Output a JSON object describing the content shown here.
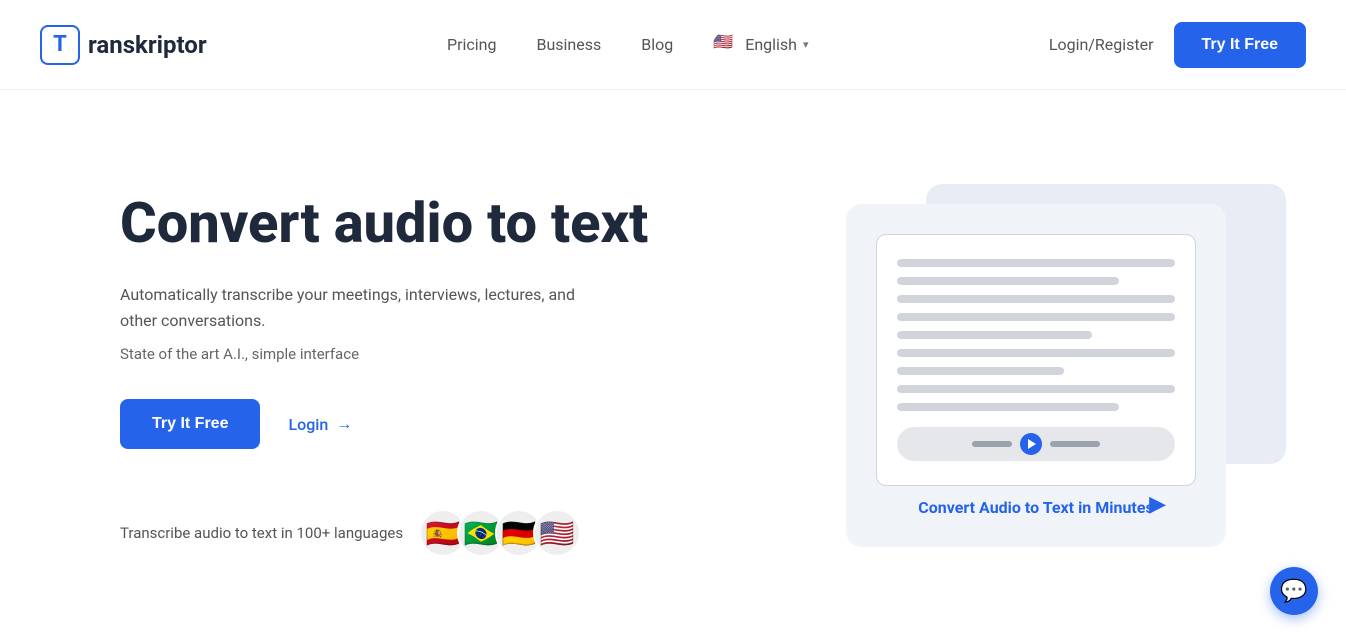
{
  "nav": {
    "logo_letter": "T",
    "logo_name": "ranskriptor",
    "links": [
      {
        "label": "Pricing",
        "href": "#"
      },
      {
        "label": "Business",
        "href": "#"
      },
      {
        "label": "Blog",
        "href": "#"
      }
    ],
    "language": "English",
    "login_label": "Login/Register",
    "try_btn": "Try It Free"
  },
  "hero": {
    "title": "Convert audio to text",
    "description": "Automatically transcribe your meetings, interviews, lectures, and other conversations.",
    "subtitle": "State of the art A.I., simple interface",
    "try_btn": "Try It Free",
    "login_label": "Login",
    "languages_text": "Transcribe audio to text in 100+ languages",
    "flags": [
      "🇪🇸",
      "🇧🇷",
      "🇩🇪",
      "🇺🇸"
    ]
  },
  "illustration": {
    "convert_label": "Convert Audio to Text in Minutes"
  },
  "colors": {
    "primary": "#2563eb",
    "text_dark": "#1e293b",
    "text_muted": "#555"
  }
}
